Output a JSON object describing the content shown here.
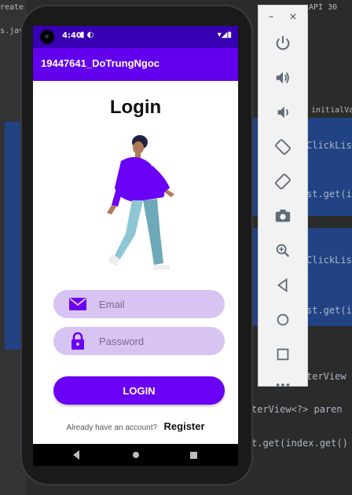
{
  "ide": {
    "tab_text": "reate",
    "file_text": "s.java",
    "api_label": "API 30",
    "hint_text": "initialValu",
    "code_lines": [
      "ClickLis",
      "st.get(i",
      "ClickLis",
      "st.get(i",
      "terView",
      "terView<?> paren",
      "t.get(index.get()"
    ]
  },
  "phone": {
    "status_time": "4:40",
    "status_icons": "▮ ◐",
    "status_right": "▾◢▮",
    "app_title": "19447641_DoTrungNgoc",
    "login_title": "Login",
    "email_placeholder": "Email",
    "password_placeholder": "Password",
    "login_button": "LOGIN",
    "account_text": "Already have an account?",
    "register_link": "Register"
  },
  "colors": {
    "status_bar": "#3700b3",
    "app_bar": "#6200ee",
    "field_bg": "#d7c4f3",
    "button": "#6a00f4",
    "icon": "#6a00f4"
  },
  "emulator": {
    "minimize": "–",
    "close": "×",
    "buttons": [
      "power-icon",
      "volume-up-icon",
      "volume-down-icon",
      "rotate-left-icon",
      "rotate-right-icon",
      "camera-icon",
      "zoom-icon",
      "back-icon",
      "home-icon",
      "overview-icon",
      "more-icon"
    ]
  }
}
